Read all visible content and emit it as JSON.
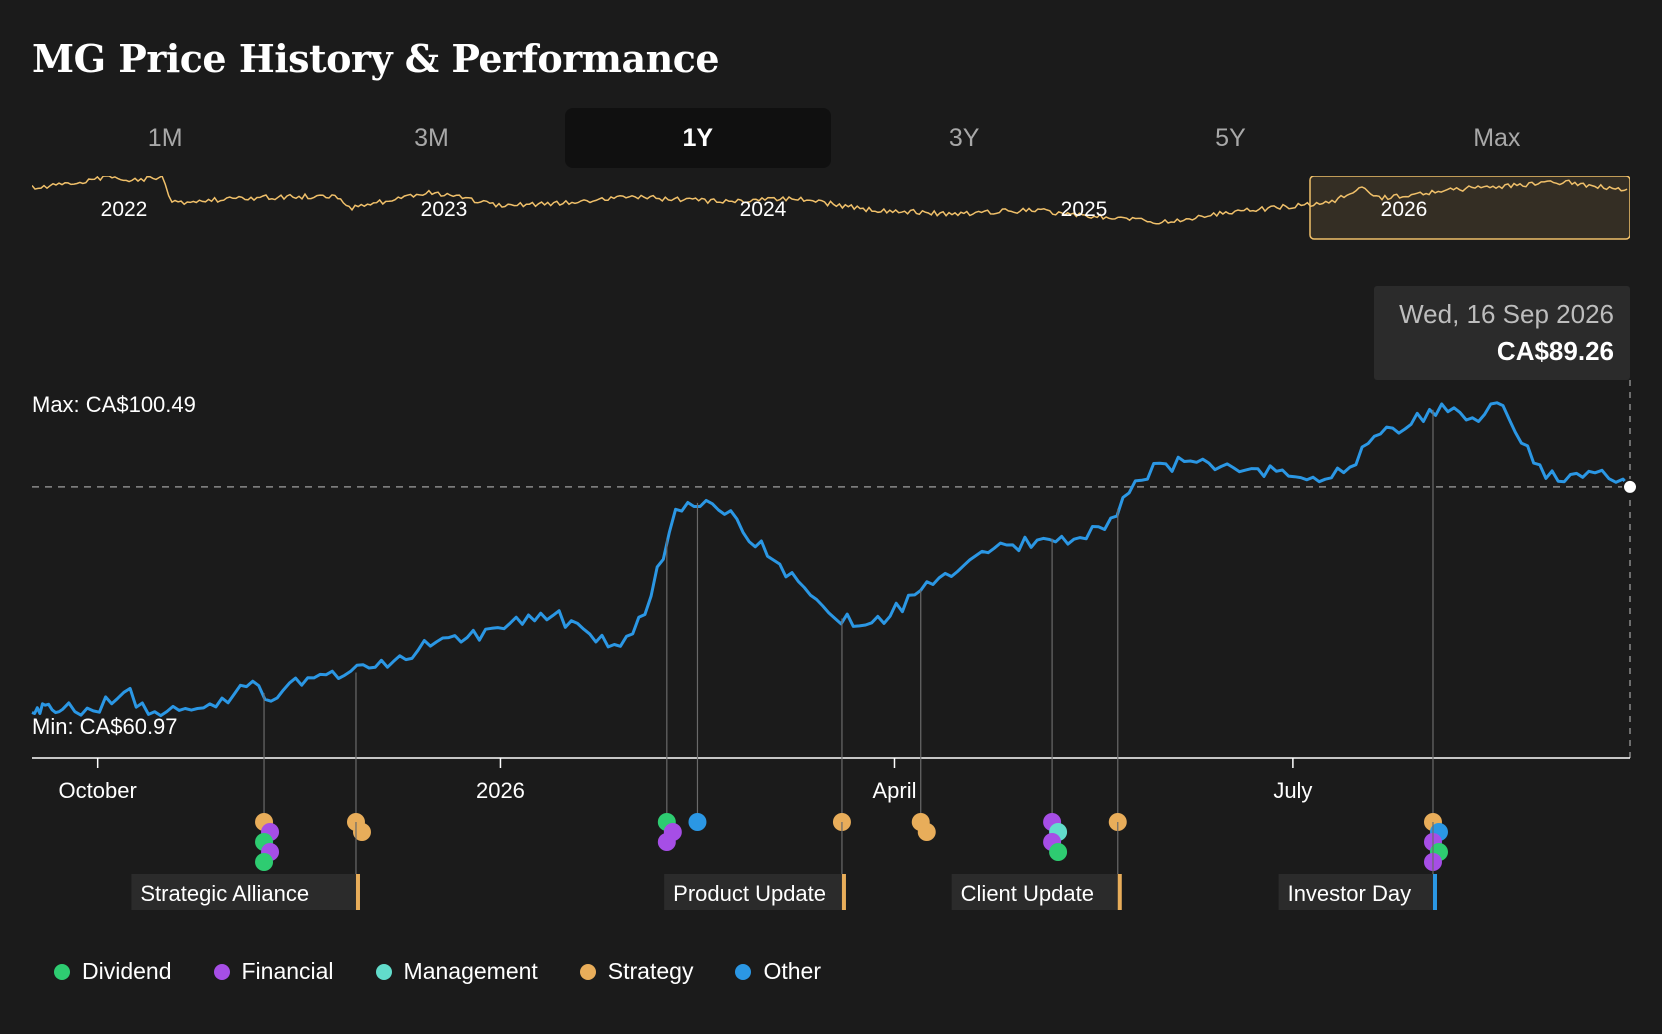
{
  "title": "MG Price History & Performance",
  "tabs": [
    {
      "label": "1M",
      "active": false
    },
    {
      "label": "3M",
      "active": false
    },
    {
      "label": "1Y",
      "active": true
    },
    {
      "label": "3Y",
      "active": false
    },
    {
      "label": "5Y",
      "active": false
    },
    {
      "label": "Max",
      "active": false
    }
  ],
  "colors": {
    "price_line": "#2b97e4",
    "navigator_line": "#f0c06a",
    "navigator_window_border": "#f0c06a",
    "background": "#1b1b1b",
    "tooltip_bg": "#2b2b2b"
  },
  "tooltip": {
    "date": "Wed, 16 Sep 2026",
    "price": "CA$89.26"
  },
  "navigator": {
    "year_labels": [
      "2022",
      "2023",
      "2024",
      "2025",
      "2026"
    ],
    "selected_range": [
      "2025-09-16",
      "2026-09-16"
    ]
  },
  "legend": [
    {
      "label": "Dividend",
      "color": "#2ecc71"
    },
    {
      "label": "Financial",
      "color": "#a64ee6"
    },
    {
      "label": "Management",
      "color": "#62dccb"
    },
    {
      "label": "Strategy",
      "color": "#e8ad5a"
    },
    {
      "label": "Other",
      "color": "#2b97e4"
    }
  ],
  "event_colors": {
    "dividend": "#2ecc71",
    "financial": "#a64ee6",
    "management": "#62dccb",
    "strategy": "#e8ad5a",
    "other": "#2b97e4"
  },
  "chart_data": {
    "type": "line",
    "x_range": [
      "2025-09-16",
      "2026-09-16"
    ],
    "ylim": [
      60.97,
      100.49
    ],
    "min_label": "Min: CA$60.97",
    "max_label": "Max: CA$100.49",
    "reference_price": 89.26,
    "x_ticks": [
      {
        "date": "2025-10-01",
        "label": "October"
      },
      {
        "date": "2026-01-01",
        "label": "2026"
      },
      {
        "date": "2026-04-01",
        "label": "April"
      },
      {
        "date": "2026-07-01",
        "label": "July"
      }
    ],
    "series": [
      {
        "x": [
          "2025-09-16",
          "2025-09-19",
          "2025-09-23",
          "2025-09-30",
          "2025-10-07",
          "2025-10-14",
          "2025-10-21",
          "2025-10-28",
          "2025-11-04",
          "2025-11-11",
          "2025-11-18",
          "2025-11-25",
          "2025-12-02",
          "2025-12-09",
          "2025-12-16",
          "2025-12-23",
          "2025-12-30",
          "2026-01-06",
          "2026-01-13",
          "2026-01-20",
          "2026-01-27",
          "2026-02-03",
          "2026-02-10",
          "2026-02-17",
          "2026-02-24",
          "2026-03-03",
          "2026-03-10",
          "2026-03-17",
          "2026-03-24",
          "2026-03-31",
          "2026-04-07",
          "2026-04-14",
          "2026-04-21",
          "2026-04-28",
          "2026-05-05",
          "2026-05-12",
          "2026-05-19",
          "2026-05-26",
          "2026-06-02",
          "2026-06-09",
          "2026-06-16",
          "2026-06-23",
          "2026-06-30",
          "2026-07-07",
          "2026-07-14",
          "2026-07-21",
          "2026-07-28",
          "2026-08-04",
          "2026-08-11",
          "2026-08-18",
          "2026-08-25",
          "2026-09-01",
          "2026-09-08",
          "2026-09-16"
        ],
        "values": [
          61.4,
          62.3,
          61.8,
          61.6,
          63.9,
          61.5,
          61.9,
          62.1,
          64.6,
          63.2,
          65.7,
          65.6,
          66.9,
          68.4,
          69.6,
          70.1,
          71.8,
          72.3,
          73.4,
          71.7,
          69.8,
          73.5,
          86.5,
          87.6,
          85.3,
          80.7,
          77.6,
          73.7,
          72.1,
          73.3,
          76.5,
          78.2,
          81.3,
          82.1,
          82.9,
          82.8,
          84.0,
          90.0,
          92.1,
          92.3,
          92.1,
          91.5,
          90.6,
          89.9,
          91.7,
          95.8,
          97.0,
          99.5,
          97.8,
          99.3,
          92.2,
          89.9,
          91.0,
          89.26
        ]
      }
    ],
    "events": [
      {
        "date": "2025-11-08",
        "categories": [
          "strategy",
          "financial",
          "dividend",
          "financial",
          "dividend"
        ]
      },
      {
        "date": "2025-11-29",
        "categories": [
          "strategy",
          "strategy"
        ]
      },
      {
        "date": "2026-02-08",
        "categories": [
          "dividend",
          "financial",
          "financial"
        ]
      },
      {
        "date": "2026-02-15",
        "categories": [
          "other"
        ]
      },
      {
        "date": "2026-03-20",
        "categories": [
          "strategy"
        ]
      },
      {
        "date": "2026-04-07",
        "categories": [
          "strategy",
          "strategy"
        ]
      },
      {
        "date": "2026-05-07",
        "categories": [
          "financial",
          "management",
          "financial",
          "dividend"
        ]
      },
      {
        "date": "2026-05-22",
        "categories": [
          "strategy"
        ]
      },
      {
        "date": "2026-08-02",
        "categories": [
          "strategy",
          "other",
          "financial",
          "dividend",
          "financial"
        ]
      }
    ],
    "event_labels": [
      {
        "date": "2025-11-29",
        "text": "Strategic Alliance",
        "category": "strategy"
      },
      {
        "date": "2026-03-20",
        "text": "Product Update",
        "category": "strategy"
      },
      {
        "date": "2026-05-22",
        "text": "Client Update",
        "category": "strategy"
      },
      {
        "date": "2026-08-02",
        "text": "Investor Day",
        "category": "other"
      }
    ]
  }
}
